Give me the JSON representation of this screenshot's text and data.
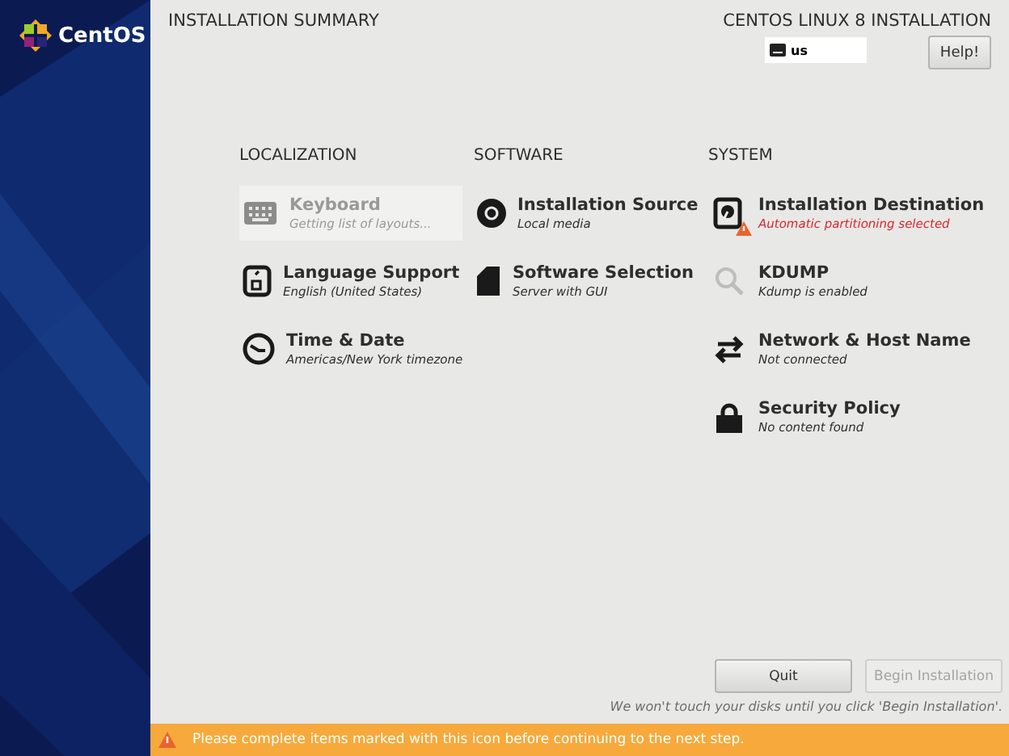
{
  "sidebar": {
    "logo_text": "CentOS"
  },
  "header": {
    "title": "INSTALLATION SUMMARY",
    "product": "CENTOS LINUX 8 INSTALLATION",
    "keyboard_layout": "us",
    "help_button": "Help!"
  },
  "sections": [
    {
      "title": "LOCALIZATION",
      "items": [
        {
          "kind": "keyboard",
          "name": "Keyboard",
          "status": "Getting list of layouts...",
          "disabled": true,
          "warning": false
        },
        {
          "kind": "language",
          "name": "Language Support",
          "status": "English (United States)",
          "disabled": false,
          "warning": false
        },
        {
          "kind": "clock",
          "name": "Time & Date",
          "status": "Americas/New York timezone",
          "disabled": false,
          "warning": false
        }
      ]
    },
    {
      "title": "SOFTWARE",
      "items": [
        {
          "kind": "disc",
          "name": "Installation Source",
          "status": "Local media",
          "disabled": false,
          "warning": false
        },
        {
          "kind": "package",
          "name": "Software Selection",
          "status": "Server with GUI",
          "disabled": false,
          "warning": false
        }
      ]
    },
    {
      "title": "SYSTEM",
      "items": [
        {
          "kind": "disk",
          "name": "Installation Destination",
          "status": "Automatic partitioning selected",
          "disabled": false,
          "warning": true
        },
        {
          "kind": "search",
          "name": "KDUMP",
          "status": "Kdump is enabled",
          "disabled": false,
          "warning": false
        },
        {
          "kind": "arrows",
          "name": "Network & Host Name",
          "status": "Not connected",
          "disabled": false,
          "warning": false
        },
        {
          "kind": "lock",
          "name": "Security Policy",
          "status": "No content found",
          "disabled": false,
          "warning": false
        }
      ]
    }
  ],
  "buttons": [
    {
      "label": "Quit",
      "disabled": false
    },
    {
      "label": "Begin Installation",
      "disabled": true
    }
  ],
  "footer_note": "We won't touch your disks until you click 'Begin Installation'.",
  "warning_bar": "Please complete items marked with this icon before continuing to the next step."
}
